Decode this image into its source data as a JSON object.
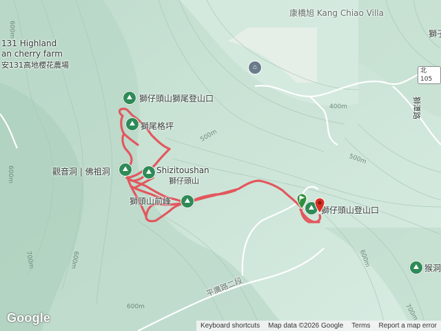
{
  "labels": {
    "villa": "康橋旭 Kang Chiao Villa",
    "farm_en_1": "131 Highland",
    "farm_en_2": "an cherry farm",
    "farm_zh": "安131高地櫻花農場",
    "shizi_tail": "獅仔頭山獅尾登山口",
    "weige": "獅尾格坪",
    "guanyin": "觀音洞 | 佛祖洞",
    "shizitoushan_en": "Shizitoushan",
    "shizitoushan_zh": "獅仔頭山",
    "front_peak": "獅頭山前峰",
    "trailhead": "獅仔頭山登山口",
    "lion_right": "獅子頭",
    "monkey_cave": "猴洞",
    "road_right": "獅潭路",
    "road_bottom": "平廣路二段"
  },
  "route_badge": "北105",
  "contours": [
    "600m",
    "600m",
    "600m",
    "600m",
    "500m",
    "400m",
    "700m",
    "700m",
    "500m",
    "600m"
  ],
  "colors": {
    "route": "#e2575e",
    "poi": "#2e8b57",
    "terrain": "#cfe6da"
  },
  "footer": {
    "brand": "Google",
    "shortcuts": "Keyboard shortcuts",
    "mapdata": "Map data ©2026 Google",
    "terms": "Terms",
    "report": "Report a map error"
  },
  "icons": [
    "trail-poi-icon",
    "school-icon",
    "start-flag-icon",
    "end-pin-icon"
  ]
}
